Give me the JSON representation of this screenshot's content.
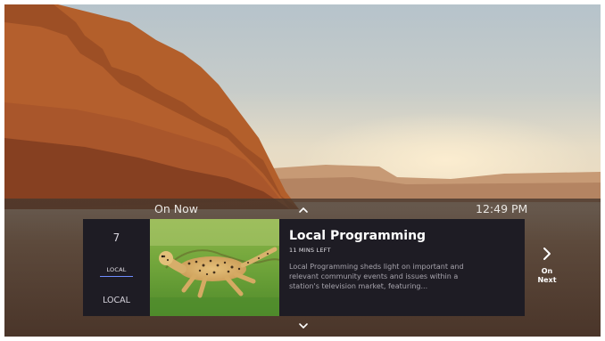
{
  "guide": {
    "section_label": "On Now",
    "clock": "12:49 PM"
  },
  "channel": {
    "number": "7",
    "badge": "LOCAL",
    "name": "LOCAL"
  },
  "program": {
    "title": "Local Programming",
    "time_left": "11 MINS LEFT",
    "description": "Local Programming sheds light on important and relevant community events and issues within a station's television market, featuring..."
  },
  "next": {
    "label_line1": "On",
    "label_line2": "Next"
  },
  "colors": {
    "panel_dark": "#1e1c24",
    "accent_underline": "#6f8cff"
  },
  "icons": {
    "up": "chevron-up-icon",
    "down": "chevron-down-icon",
    "next": "chevron-right-icon"
  }
}
